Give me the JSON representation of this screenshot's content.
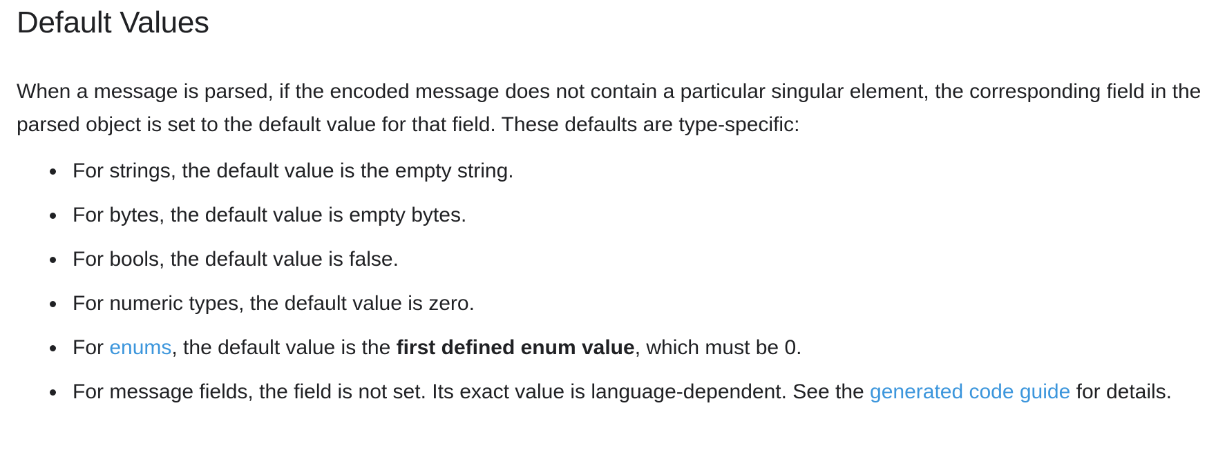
{
  "title": "Default Values",
  "intro": "When a message is parsed, if the encoded message does not contain a particular singular element, the corresponding field in the parsed object is set to the default value for that field. These defaults are type-specific:",
  "items": {
    "strings": "For strings, the default value is the empty string.",
    "bytes": "For bytes, the default value is empty bytes.",
    "bools": "For bools, the default value is false.",
    "numeric": "For numeric types, the default value is zero.",
    "enums": {
      "prefix": "For ",
      "link": "enums",
      "middle": ", the default value is the ",
      "bold": "first defined enum value",
      "suffix": ", which must be 0."
    },
    "messages": {
      "prefix": "For message fields, the field is not set. Its exact value is language-dependent. See the ",
      "link": "generated code guide",
      "suffix": " for details."
    }
  },
  "colors": {
    "text": "#202124",
    "link": "#3c96dc",
    "background": "#ffffff"
  }
}
